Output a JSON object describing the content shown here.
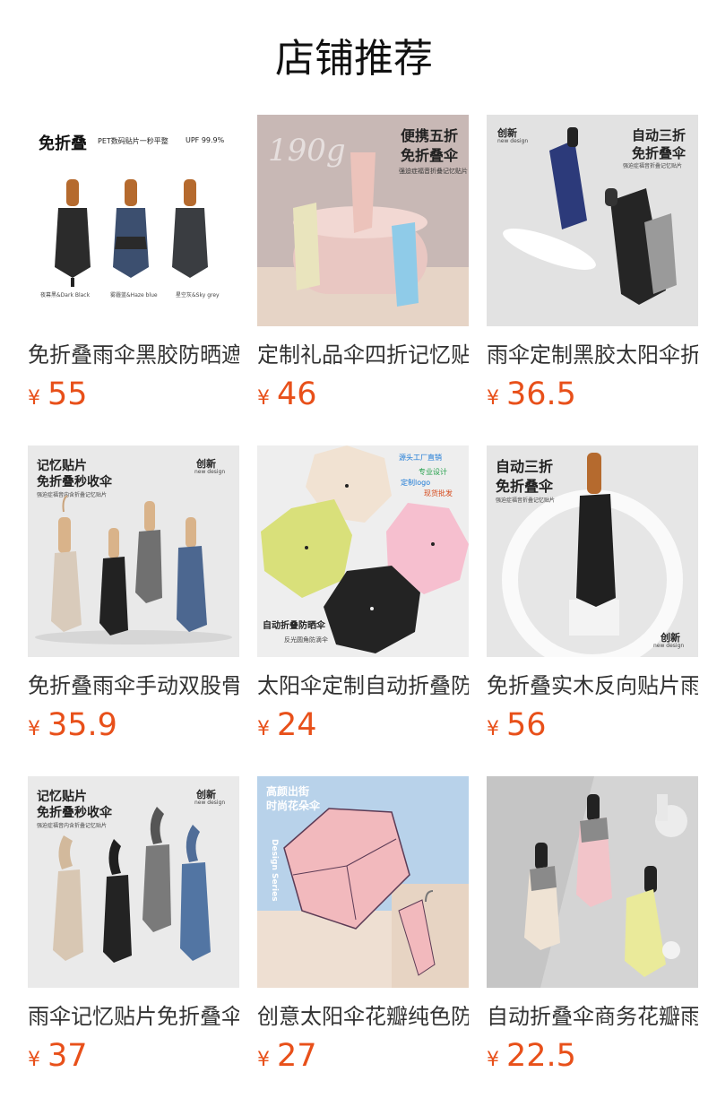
{
  "page": {
    "title": "店铺推荐"
  },
  "currency": "¥",
  "products": [
    {
      "name": "免折叠雨伞黑胶防晒遮阳伞",
      "price": "55",
      "image": {
        "headline": "免折叠",
        "subline": "PET数码贴片一秒平整",
        "badge": "UPF 99.9%",
        "captions": [
          "夜幕黑&Dark Black",
          "雾霾蓝&Haze blue",
          "星空灰&Sky grey"
        ]
      }
    },
    {
      "name": "定制礼品伞四折记忆贴片伞",
      "price": "46",
      "image": {
        "weight": "190g",
        "headline": "便携五折",
        "subline": "免折叠伞",
        "note": "强迫症福音折叠记忆贴片"
      }
    },
    {
      "name": "雨伞定制黑胶太阳伞折叠",
      "price": "36.5",
      "image": {
        "brand": "创新",
        "brand_sub": "new design",
        "headline": "自动三折",
        "subline": "免折叠伞",
        "note": "强迫症福音折叠记忆贴片"
      }
    },
    {
      "name": "免折叠雨伞手动双股骨",
      "price": "35.9",
      "image": {
        "headline": "记忆贴片",
        "subline": "免折叠秒收伞",
        "note": "强迫症福音内含折叠记忆贴片",
        "brand": "创新",
        "brand_sub": "new design"
      }
    },
    {
      "name": "太阳伞定制自动折叠防晒",
      "price": "24",
      "image": {
        "tags": [
          "源头工厂直销",
          "专业设计",
          "定制logo",
          "现货批发"
        ],
        "headline": "自动折叠防晒伞",
        "subline": "反光圆角防滴伞"
      }
    },
    {
      "name": "免折叠实木反向贴片雨伞",
      "price": "56",
      "image": {
        "headline": "自动三折",
        "subline": "免折叠伞",
        "note": "强迫症福音折叠记忆贴片",
        "brand": "创新",
        "brand_sub": "new design"
      }
    },
    {
      "name": "雨伞记忆贴片免折叠伞",
      "price": "37",
      "image": {
        "headline": "记忆贴片",
        "subline": "免折叠秒收伞",
        "note": "强迫症福音内含折叠记忆贴片",
        "brand": "创新",
        "brand_sub": "new design"
      }
    },
    {
      "name": "创意太阳伞花瓣纯色防晒",
      "price": "27",
      "image": {
        "headline": "高颜出街",
        "subline": "时尚花朵伞",
        "vertical": "Design Series"
      }
    },
    {
      "name": "自动折叠伞商务花瓣雨伞",
      "price": "22.5",
      "image": {}
    }
  ],
  "colors": {
    "price": "#e8501a",
    "title": "#111111",
    "name": "#333333"
  }
}
